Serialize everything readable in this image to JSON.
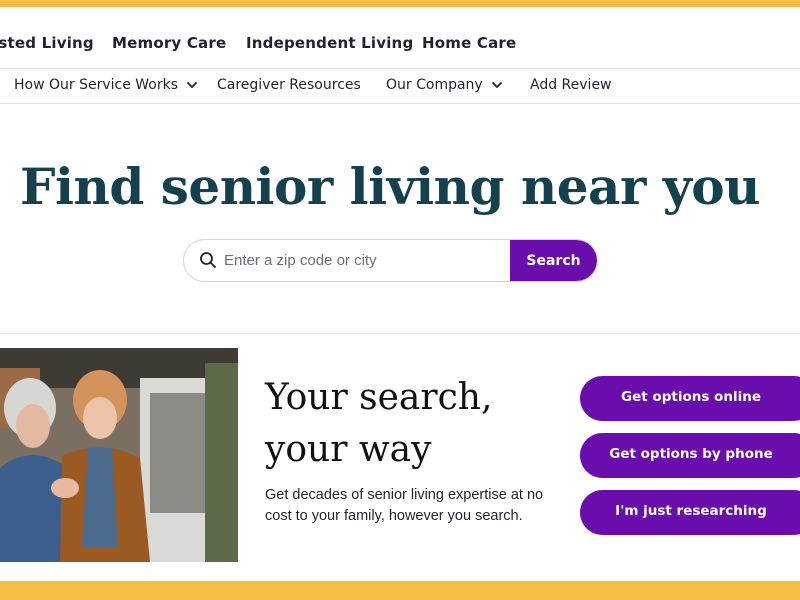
{
  "colors": {
    "accent_yellow": "#f6bd45",
    "brand_purple": "#6a0dad",
    "heading_teal": "#15414e"
  },
  "nav_primary": [
    {
      "label": "Assisted Living"
    },
    {
      "label": "Memory Care"
    },
    {
      "label": "Independent Living"
    },
    {
      "label": "Home Care"
    }
  ],
  "nav_secondary": [
    {
      "label": "How Our Service Works",
      "has_dropdown": true,
      "icon": "chevron-down-icon"
    },
    {
      "label": "Caregiver Resources",
      "has_dropdown": false
    },
    {
      "label": "Our Company",
      "has_dropdown": true,
      "icon": "chevron-down-icon"
    },
    {
      "label": "Add Review",
      "has_dropdown": false
    }
  ],
  "hero": {
    "title": "Find senior living near you"
  },
  "search": {
    "icon": "search-icon",
    "placeholder": "Enter a zip code or city",
    "value": "",
    "button_label": "Search"
  },
  "promo": {
    "title_line1": "Your search,",
    "title_line2": "your way",
    "description": "Get decades of senior living expertise at no cost to your family, however you search.",
    "photo": "two-senior-women-embracing-outdoors"
  },
  "options": [
    {
      "label": "Get options online"
    },
    {
      "label": "Get options by phone"
    },
    {
      "label": "I'm just researching"
    }
  ]
}
